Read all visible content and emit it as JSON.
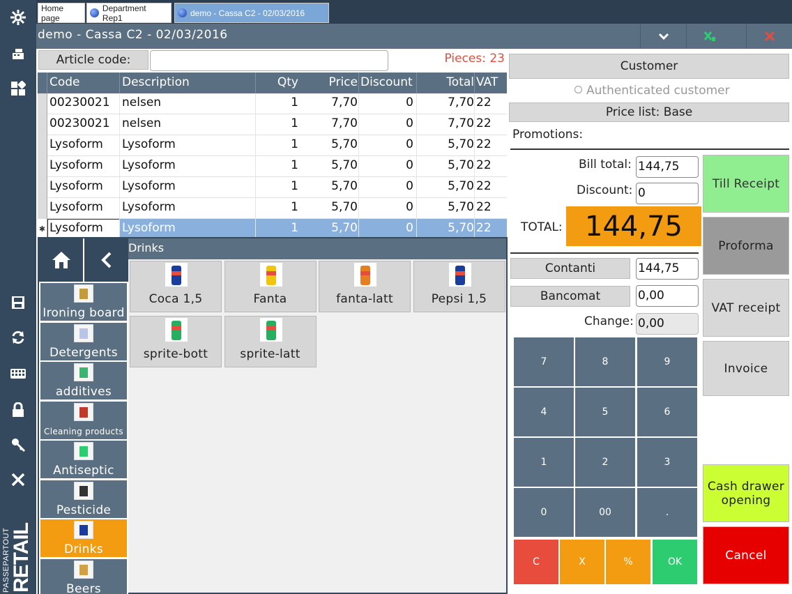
{
  "sidebar": {
    "icons": [
      "gear-icon",
      "register-icon",
      "dashboard-icon",
      "save-icon",
      "refresh-icon",
      "keyboard-icon",
      "lock-icon",
      "key-icon",
      "close-icon"
    ],
    "brand_small": "PASSEPARTOUT",
    "brand_large": "RETAIL"
  },
  "tabs": [
    {
      "label": "Home page",
      "active": false
    },
    {
      "label": "Department Rep1",
      "active": false
    },
    {
      "label": "demo - Cassa C2 - 02/03/2016",
      "active": true
    }
  ],
  "titlebar": {
    "title": "demo - Cassa C2 - 02/03/2016"
  },
  "article": {
    "label": "Article code:",
    "value": "",
    "pieces": "Pieces: 23"
  },
  "grid": {
    "columns": [
      "Code",
      "Description",
      "Qty",
      "Price",
      "Discount",
      "Total",
      "VAT"
    ],
    "rows": [
      {
        "code": "00230021",
        "description": "nelsen",
        "qty": "1",
        "price": "7,70",
        "discount": "0",
        "total": "7,70",
        "vat": "22",
        "selected": false
      },
      {
        "code": "00230021",
        "description": "nelsen",
        "qty": "1",
        "price": "7,70",
        "discount": "0",
        "total": "7,70",
        "vat": "22",
        "selected": false
      },
      {
        "code": "Lysoform",
        "description": "Lysoform",
        "qty": "1",
        "price": "5,70",
        "discount": "0",
        "total": "5,70",
        "vat": "22",
        "selected": false
      },
      {
        "code": "Lysoform",
        "description": "Lysoform",
        "qty": "1",
        "price": "5,70",
        "discount": "0",
        "total": "5,70",
        "vat": "22",
        "selected": false
      },
      {
        "code": "Lysoform",
        "description": "Lysoform",
        "qty": "1",
        "price": "5,70",
        "discount": "0",
        "total": "5,70",
        "vat": "22",
        "selected": false
      },
      {
        "code": "Lysoform",
        "description": "Lysoform",
        "qty": "1",
        "price": "5,70",
        "discount": "0",
        "total": "5,70",
        "vat": "22",
        "selected": false
      },
      {
        "code": "Lysoform",
        "description": "Lysoform",
        "qty": "1",
        "price": "5,70",
        "discount": "0",
        "total": "5,70",
        "vat": "22",
        "selected": true
      }
    ]
  },
  "categories": {
    "home_icon": "home-icon",
    "back_icon": "chevron-left-icon",
    "items": [
      {
        "label": "Ironing board",
        "small": false,
        "active": false
      },
      {
        "label": "Detergents",
        "small": false,
        "active": false
      },
      {
        "label": "additives",
        "small": false,
        "active": false
      },
      {
        "label": "Cleaning products",
        "small": true,
        "active": false
      },
      {
        "label": "Antiseptic",
        "small": false,
        "active": false
      },
      {
        "label": "Pesticide",
        "small": false,
        "active": false
      },
      {
        "label": "Drinks",
        "small": false,
        "active": true
      },
      {
        "label": "Beers",
        "small": false,
        "active": false
      }
    ],
    "current_title": "Drinks",
    "products": [
      {
        "label": "Coca 1,5",
        "img_color": "#1a3c9c"
      },
      {
        "label": "Fanta",
        "img_color": "#f1c40f"
      },
      {
        "label": "fanta-latt",
        "img_color": "#e67e22"
      },
      {
        "label": "Pepsi 1,5",
        "img_color": "#1a3c9c"
      },
      {
        "label": "sprite-bott",
        "img_color": "#27ae60"
      },
      {
        "label": "sprite-latt",
        "img_color": "#27ae60"
      }
    ]
  },
  "customer": {
    "button": "Customer",
    "authenticated": "Authenticated customer",
    "price_list": "Price list: Base",
    "promotions": "Promotions:"
  },
  "totals": {
    "bill_total_label": "Bill total:",
    "bill_total": "144,75",
    "discount_label": "Discount:",
    "discount": "0",
    "total_label": "TOTAL:",
    "total": "144,75"
  },
  "payments": {
    "cash_label": "Contanti",
    "cash_value": "144,75",
    "card_label": "Bancomat",
    "card_value": "0,00",
    "change_label": "Change:",
    "change_value": "0,00"
  },
  "keypad": {
    "keys": [
      "7",
      "8",
      "9",
      "4",
      "5",
      "6",
      "1",
      "2",
      "3",
      "0",
      "00",
      "."
    ],
    "bottom": [
      {
        "label": "C",
        "color": "#e74c3c"
      },
      {
        "label": "X",
        "color": "#f39c12"
      },
      {
        "label": "%",
        "color": "#f39c12"
      },
      {
        "label": "OK",
        "color": "#2ecc71"
      }
    ]
  },
  "actions": {
    "till_receipt": "Till Receipt",
    "proforma": "Proforma",
    "vat_receipt": "VAT receipt",
    "invoice": "Invoice",
    "cash_drawer": "Cash drawer opening",
    "cancel": "Cancel"
  },
  "colors": {
    "sidebar": "#34495e",
    "header": "#5b6f82",
    "accent_orange": "#f39c12",
    "till_green": "#90ee90",
    "cash_drawer_yellow": "#ccff33",
    "cancel_red": "#e60000",
    "selected_row": "#8ab1de"
  }
}
